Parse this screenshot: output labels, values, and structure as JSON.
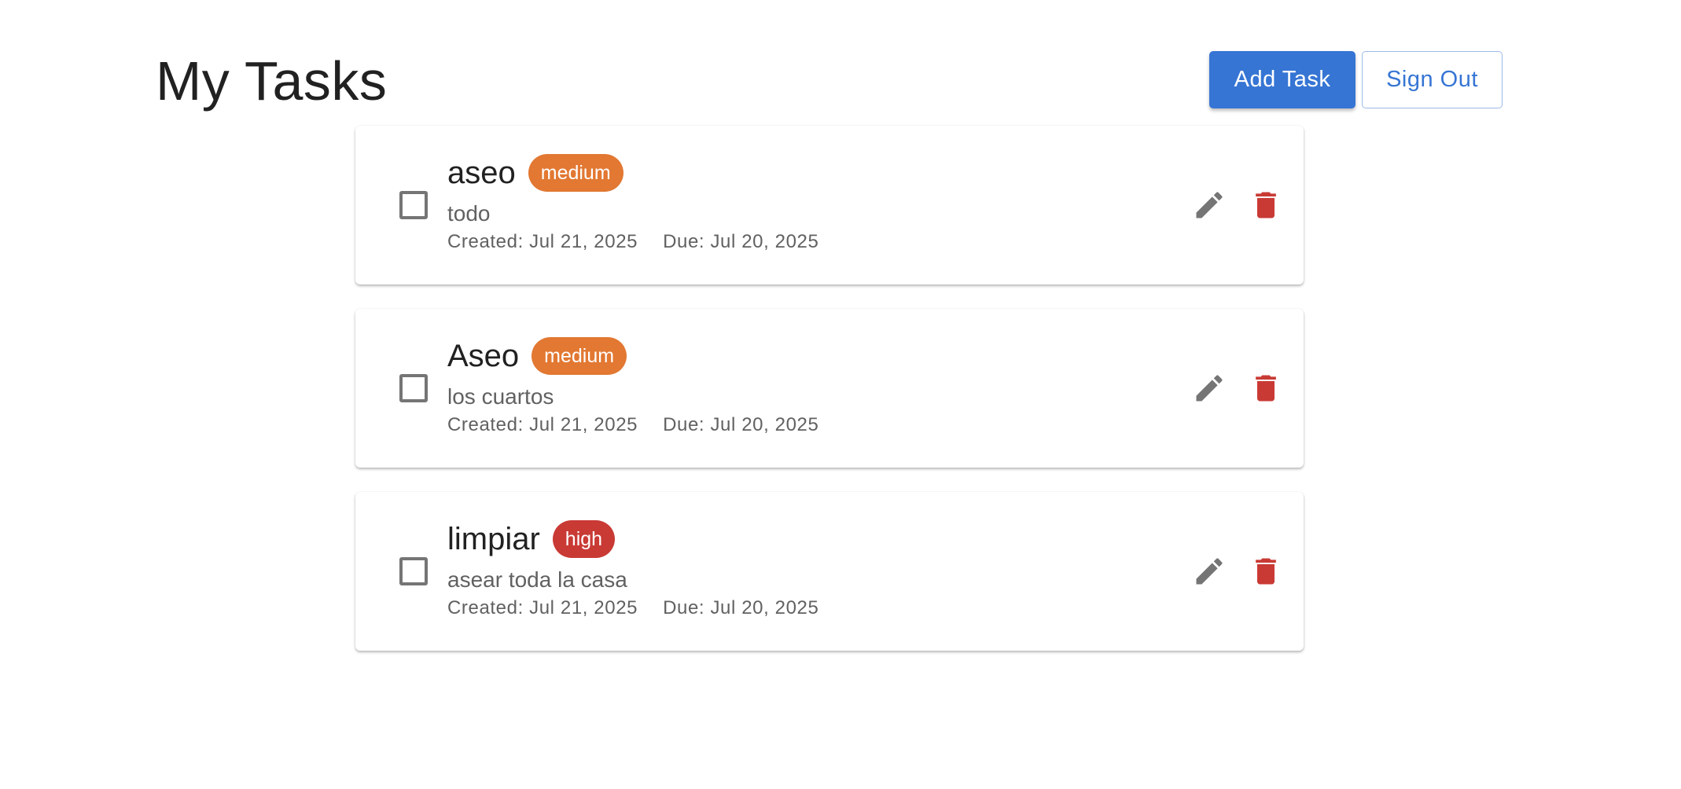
{
  "header": {
    "title": "My Tasks",
    "add_task_label": "Add Task",
    "sign_out_label": "Sign Out"
  },
  "colors": {
    "primary": "#3675d4",
    "priority_medium": "#e27832",
    "priority_high": "#c93a35",
    "icon_gray": "#757575",
    "delete_red": "#c93a35"
  },
  "icons": {
    "edit": "pencil-icon",
    "delete": "trash-icon",
    "checkbox": "checkbox-unchecked"
  },
  "tasks": [
    {
      "title": "aseo",
      "priority": "medium",
      "description": "todo",
      "created": "Created: Jul 21, 2025",
      "due": "Due: Jul 20, 2025",
      "completed": false
    },
    {
      "title": "Aseo",
      "priority": "medium",
      "description": "los cuartos",
      "created": "Created: Jul 21, 2025",
      "due": "Due: Jul 20, 2025",
      "completed": false
    },
    {
      "title": "limpiar",
      "priority": "high",
      "description": "asear toda la casa",
      "created": "Created: Jul 21, 2025",
      "due": "Due: Jul 20, 2025",
      "completed": false
    }
  ]
}
